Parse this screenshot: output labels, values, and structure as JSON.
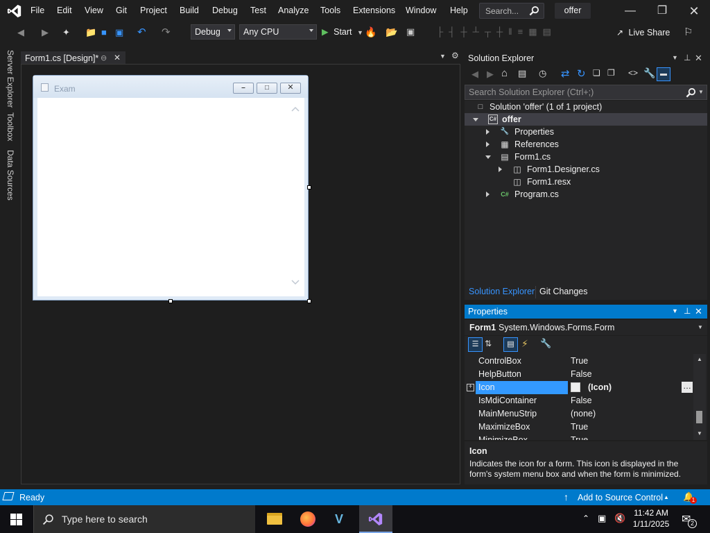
{
  "menu": {
    "items": [
      "File",
      "Edit",
      "View",
      "Git",
      "Project",
      "Build",
      "Debug",
      "Test",
      "Analyze",
      "Tools",
      "Extensions",
      "Window",
      "Help"
    ],
    "search_placeholder": "Search...",
    "solution_name": "offer"
  },
  "toolbar": {
    "config": "Debug",
    "platform": "Any CPU",
    "start_label": "Start",
    "live_share_label": "Live Share"
  },
  "left_rail": {
    "tabs": [
      "Server Explorer",
      "Toolbox",
      "Data Sources"
    ]
  },
  "document": {
    "tab_label": "Form1.cs [Design]*",
    "form_title": "Exam"
  },
  "solution_explorer": {
    "title": "Solution Explorer",
    "search_placeholder": "Search Solution Explorer (Ctrl+;)",
    "tree": [
      {
        "label": "Solution 'offer' (1 of 1 project)"
      },
      {
        "label": "offer"
      },
      {
        "label": "Properties"
      },
      {
        "label": "References"
      },
      {
        "label": "Form1.cs"
      },
      {
        "label": "Form1.Designer.cs"
      },
      {
        "label": "Form1.resx"
      },
      {
        "label": "Program.cs"
      }
    ],
    "tabs": [
      "Solution Explorer",
      "Git Changes"
    ]
  },
  "properties": {
    "title": "Properties",
    "object_name": "Form1",
    "object_type": "System.Windows.Forms.Form",
    "rows": [
      {
        "name": "ControlBox",
        "value": "True"
      },
      {
        "name": "HelpButton",
        "value": "False"
      },
      {
        "name": "Icon",
        "value": "(Icon)"
      },
      {
        "name": "IsMdiContainer",
        "value": "False"
      },
      {
        "name": "MainMenuStrip",
        "value": "(none)"
      },
      {
        "name": "MaximizeBox",
        "value": "True"
      },
      {
        "name": "MinimizeBox",
        "value": "True"
      }
    ],
    "desc_title": "Icon",
    "desc_text": "Indicates the icon for a form. This icon is displayed in the form's system menu box and when the form is minimized."
  },
  "status": {
    "ready": "Ready",
    "source_control": "Add to Source Control",
    "notifications": "1"
  },
  "taskbar": {
    "search_placeholder": "Type here to search",
    "time": "11:42 AM",
    "date": "1/11/2025",
    "notifications": "2"
  },
  "colors": {
    "accent": "#007acc",
    "background": "#1f1f1f",
    "panel": "#252526"
  }
}
